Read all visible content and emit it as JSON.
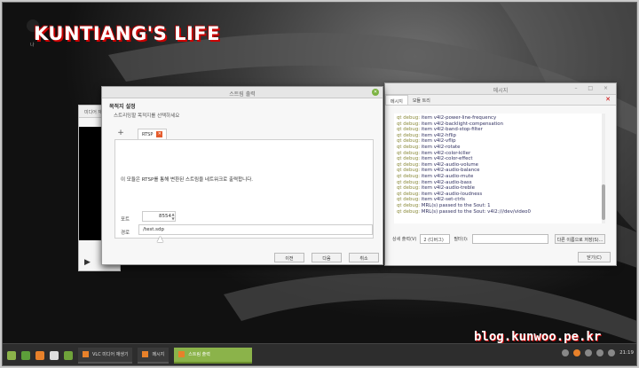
{
  "branding": {
    "logo": "KUNTIANG'S LIFE",
    "logo_sub": "나",
    "watermark": "blog.kunwoo.pe.kr"
  },
  "vlc": {
    "menu": "미디어 재생...",
    "play_icon": "play-icon"
  },
  "messages_window": {
    "title": "메시지",
    "tabs": [
      "메시지",
      "모듈 트리"
    ],
    "log_prefix": "qt debug:",
    "log": [
      "item v4l2-power-line-frequency",
      "item v4l2-backlight-compensation",
      "item v4l2-band-stop-filter",
      "item v4l2-hflip",
      "item v4l2-vflip",
      "item v4l2-rotate",
      "item v4l2-color-killer",
      "item v4l2-color-effect",
      "item v4l2-audio-volume",
      "item v4l2-audio-balance",
      "item v4l2-audio-mute",
      "item v4l2-audio-bass",
      "item v4l2-audio-treble",
      "item v4l2-audio-loudness",
      "item v4l2-set-ctrls",
      "MRL(s) passed to the Sout: 1",
      "MRL(s) passed to the Sout: v4l2:///dev/video0"
    ],
    "verbosity_label": "상세 출력(V)",
    "verbosity_value": "2 (디버그)",
    "filter_label": "필터(I):",
    "save_button": "다른 이름으로 저장(S)...",
    "close_button": "닫기(C)"
  },
  "stream_dialog": {
    "title": "스트림 출력",
    "heading": "목적지 설정",
    "subheading": "스트리밍할 목적지를 선택하세요",
    "tab_label": "RTSP",
    "description": "이 모듈은 RTSP를 통해 변환된 스트림을 네트워크로 출력합니다.",
    "port_label": "포트",
    "port_value": "8554",
    "path_label": "경로",
    "path_value": "/test.sdp",
    "buttons": {
      "back": "이전",
      "next": "다음",
      "cancel": "취소"
    }
  },
  "taskbar": {
    "items": [
      "VLC 미디어 재생기",
      "메시지",
      "스트림 출력"
    ],
    "clock": "21:19"
  },
  "colors": {
    "accent": "#8bb34a",
    "vlc_orange": "#e8812a",
    "close_red": "#c00000"
  }
}
